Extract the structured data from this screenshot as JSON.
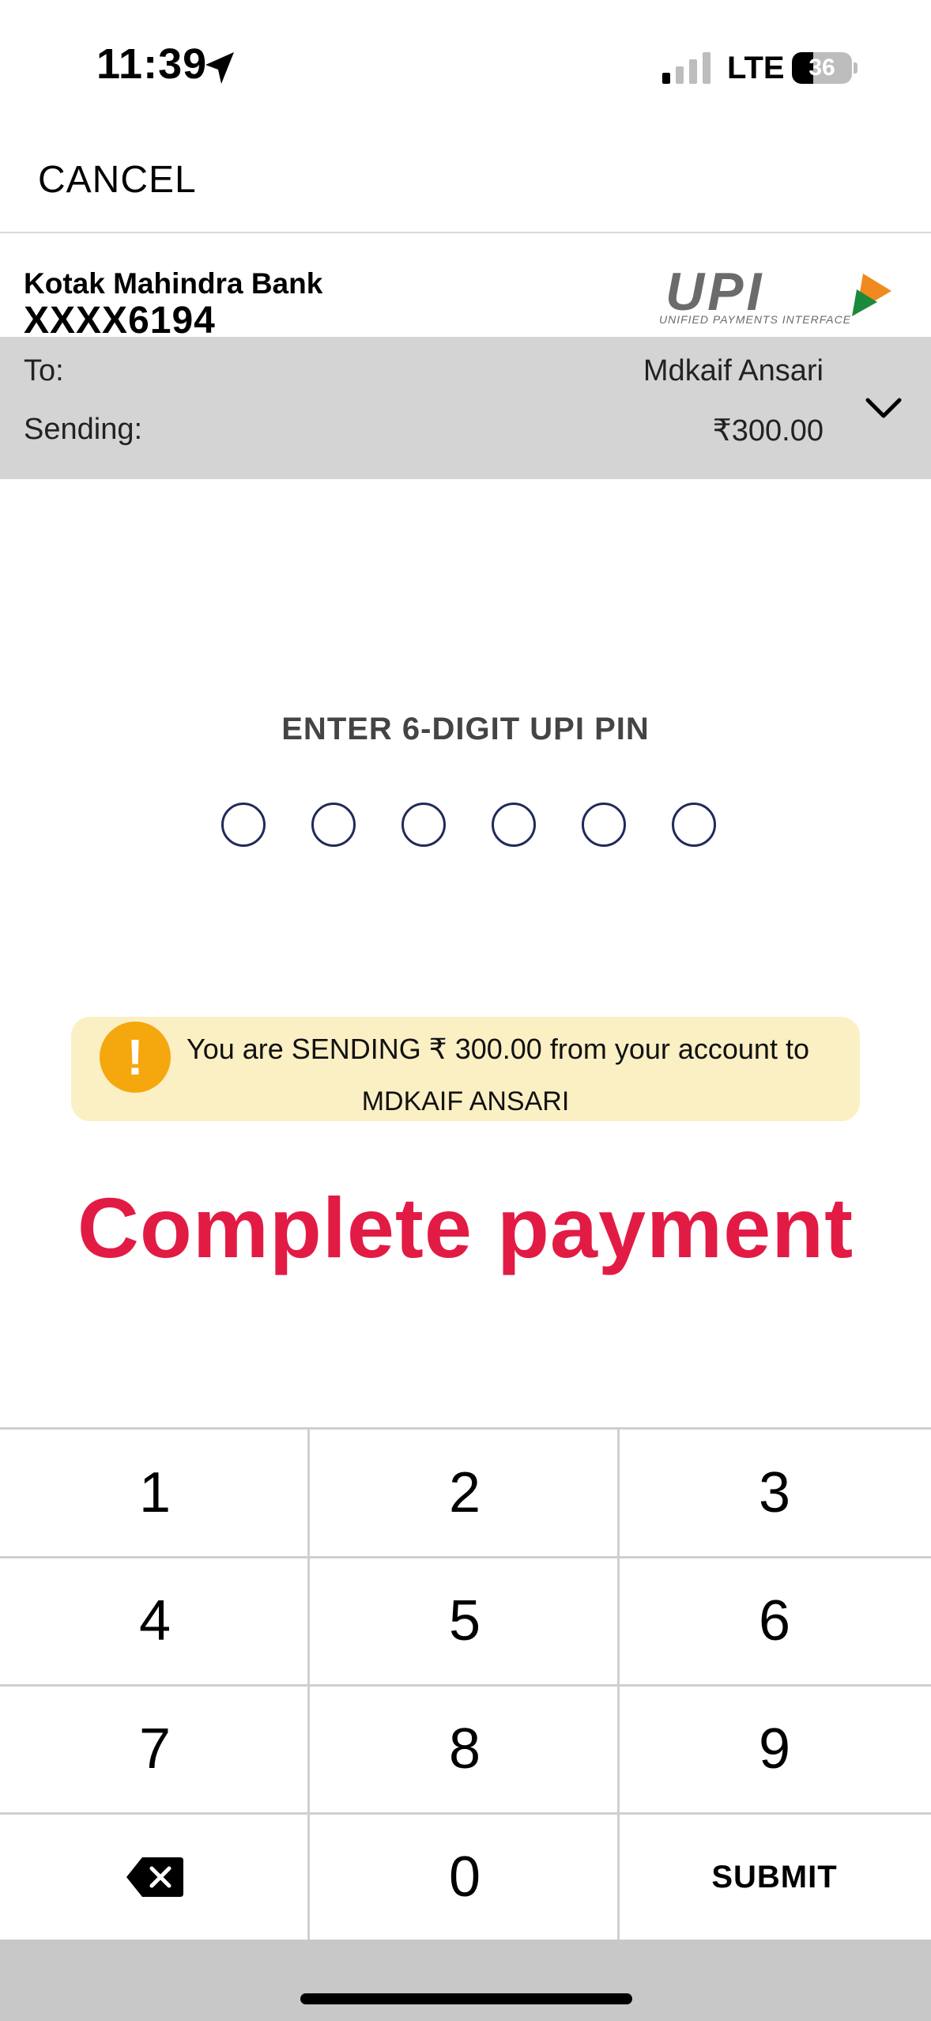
{
  "status_bar": {
    "time": "11:39",
    "network": "LTE",
    "battery": "36",
    "battery_level": 0.36
  },
  "header": {
    "cancel_label": "CANCEL",
    "bank_name": "Kotak Mahindra Bank",
    "account_number": "XXXX6194",
    "logo_text": "UPI",
    "logo_subtitle": "UNIFIED PAYMENTS INTERFACE"
  },
  "details": {
    "to_label": "To:",
    "to_value": "Mdkaif Ansari",
    "sending_label": "Sending:",
    "sending_value": "₹300.00"
  },
  "pin": {
    "title": "ENTER 6-DIGIT UPI PIN",
    "digits": 6
  },
  "warning": {
    "line1": "You are SENDING ₹ 300.00 from your account to",
    "line2": "MDKAIF ANSARI"
  },
  "overlay_text": "Complete payment",
  "keypad": {
    "keys": [
      "1",
      "2",
      "3",
      "4",
      "5",
      "6",
      "7",
      "8",
      "9",
      "",
      "0",
      "SUBMIT"
    ]
  },
  "colors": {
    "accent_red": "#e21b45",
    "warning_bg": "#fbefc4",
    "warning_icon": "#f5a70e",
    "info_bar": "#d4d4d4",
    "pin_circle": "#1f2a5a"
  }
}
